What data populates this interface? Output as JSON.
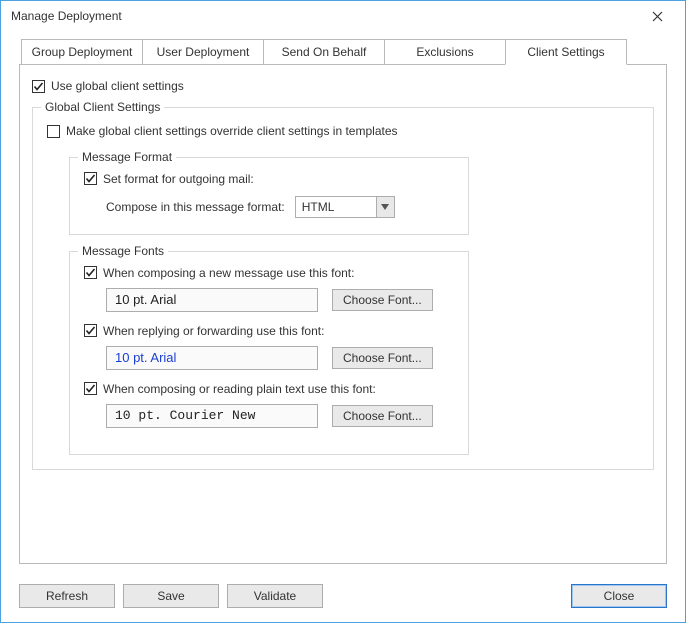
{
  "window": {
    "title": "Manage Deployment"
  },
  "tabs": {
    "group": "Group Deployment",
    "user": "User Deployment",
    "send": "Send On Behalf",
    "exclusions": "Exclusions",
    "client": "Client Settings"
  },
  "useGlobal": {
    "label": "Use global client settings"
  },
  "globalBox": {
    "legend": "Global Client Settings",
    "override": {
      "label": "Make global client settings override client settings in templates"
    }
  },
  "messageFormat": {
    "legend": "Message Format",
    "setFormat": {
      "label": "Set format for outgoing mail:"
    },
    "composeLabel": "Compose in this message format:",
    "composeValue": "HTML"
  },
  "messageFonts": {
    "legend": "Message Fonts",
    "new": {
      "label": "When composing a new message use this font:",
      "value": "10 pt. Arial",
      "btn": "Choose Font..."
    },
    "reply": {
      "label": "When replying or forwarding use this font:",
      "value": "10 pt. Arial",
      "btn": "Choose Font..."
    },
    "plain": {
      "label": "When composing or reading plain text use this font:",
      "value": "10 pt. Courier New",
      "btn": "Choose Font..."
    }
  },
  "footer": {
    "refresh": "Refresh",
    "save": "Save",
    "validate": "Validate",
    "close": "Close"
  }
}
